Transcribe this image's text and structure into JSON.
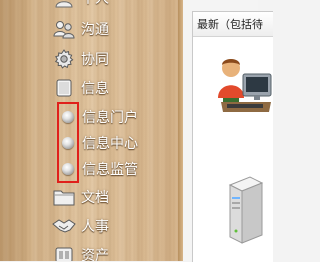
{
  "sidebar": {
    "items": [
      {
        "label": "个人",
        "icon": "person-icon"
      },
      {
        "label": "沟通",
        "icon": "chat-icon"
      },
      {
        "label": "协同",
        "icon": "gear-icon"
      },
      {
        "label": "信息",
        "icon": "document-icon"
      },
      {
        "label": "文档",
        "icon": "folder-icon"
      },
      {
        "label": "人事",
        "icon": "handshake-icon"
      },
      {
        "label": "资产",
        "icon": "asset-icon"
      }
    ],
    "sub_items": [
      {
        "label": "信息门户"
      },
      {
        "label": "信息中心"
      },
      {
        "label": "信息监管"
      }
    ]
  },
  "main": {
    "panel_title": "最新（包括待",
    "images": [
      "user-computer-icon",
      "server-icon"
    ]
  },
  "colors": {
    "highlight": "#e0201b",
    "menu_text": "#ffffff"
  }
}
